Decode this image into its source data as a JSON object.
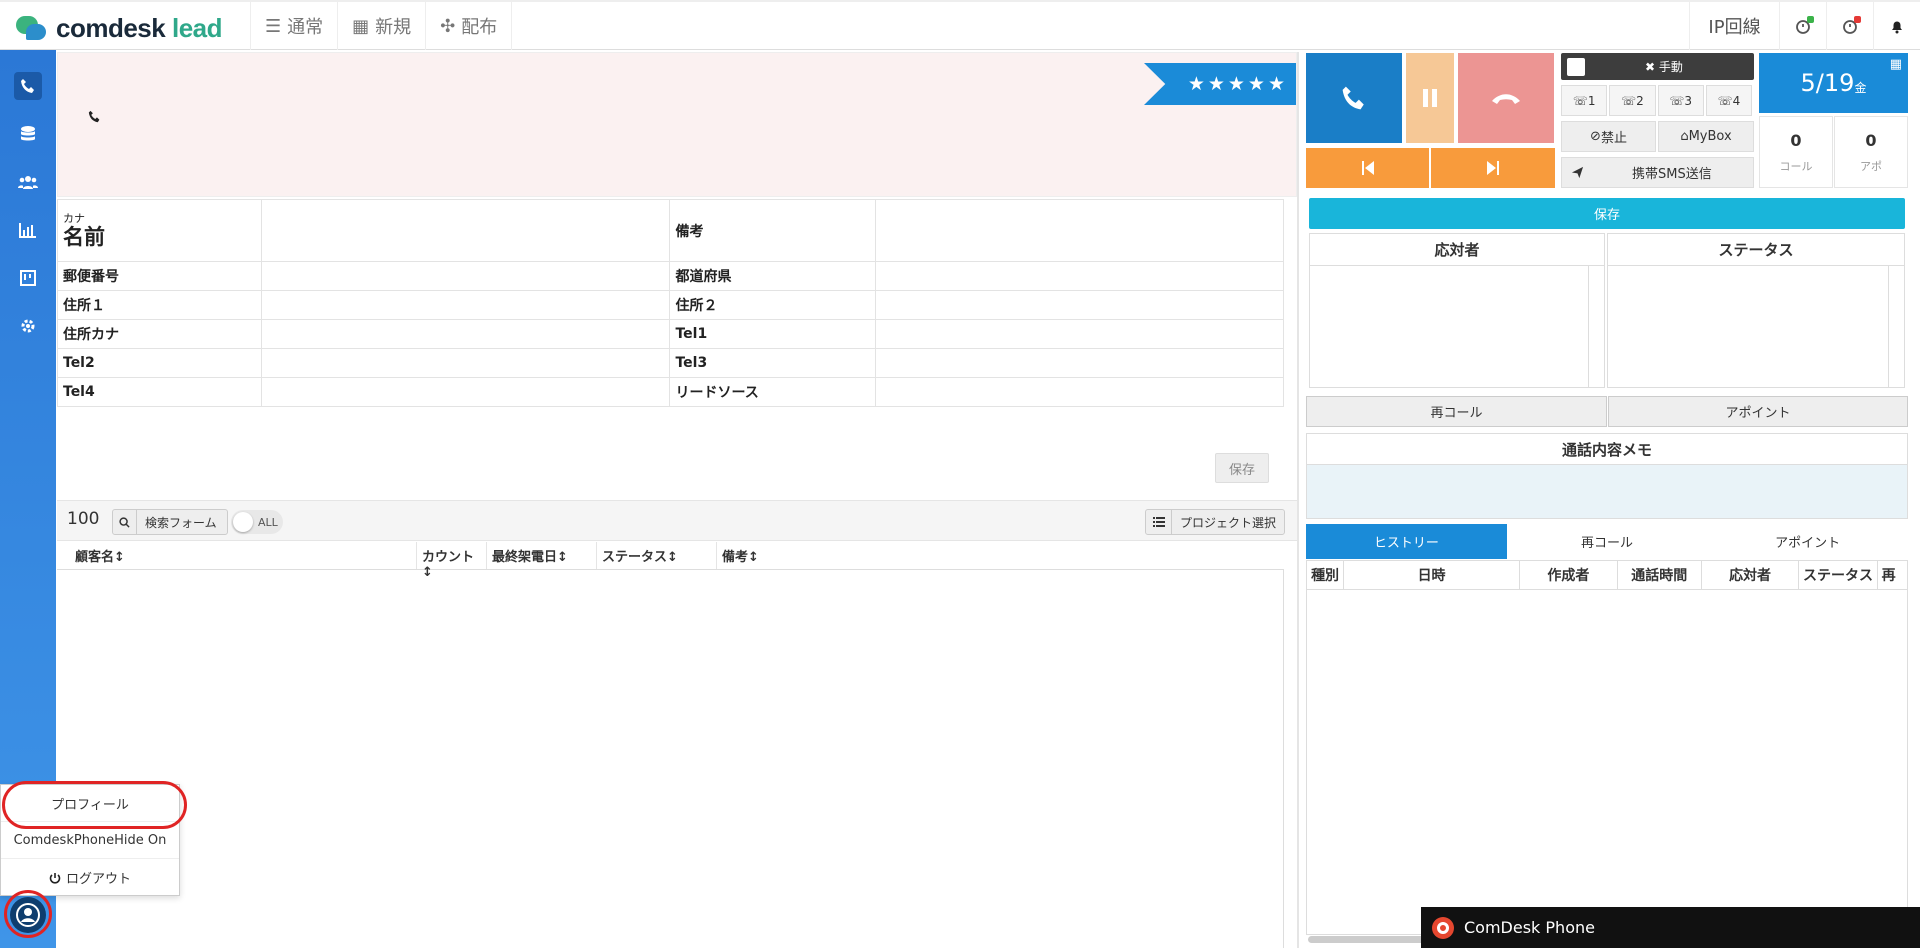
{
  "header": {
    "logo_part1": "comdesk",
    "logo_part2": "lead",
    "nav": [
      {
        "label": "通常",
        "icon": "list-icon"
      },
      {
        "label": "新規",
        "icon": "grid-icon"
      },
      {
        "label": "配布",
        "icon": "expand-icon"
      }
    ],
    "ip_label": "IP回線",
    "timer1_badge_color": "#3bb34a",
    "timer2_badge_color": "#e53935"
  },
  "sidebar": {
    "items": [
      "phone-icon",
      "database-icon",
      "users-icon",
      "chart-icon",
      "board-icon",
      "gear-icon"
    ]
  },
  "user_menu": {
    "profile": "プロフィール",
    "hide_phone": "ComdeskPhoneHide On",
    "logout": "ログアウト"
  },
  "banner": {
    "rating_stars": "★★★★★",
    "rating": 5
  },
  "customer": {
    "kana_label": "カナ",
    "name_label": "名前",
    "notes_label": "備考",
    "rows": [
      [
        "郵便番号",
        "都道府県"
      ],
      [
        "住所１",
        "住所２"
      ],
      [
        "住所カナ",
        "Tel1"
      ],
      [
        "Tel2",
        "Tel3"
      ],
      [
        "Tel4",
        "リードソース"
      ]
    ],
    "save_label": "保存"
  },
  "list_toolbar": {
    "count": "100",
    "search_label": "検索フォーム",
    "toggle_label": "ALL",
    "project_label": "プロジェクト選択"
  },
  "list_columns": [
    "顧客名",
    "カウント",
    "最終架電日",
    "ステータス",
    "備考"
  ],
  "call_panel": {
    "manual_label": "手動",
    "lines": [
      "1",
      "2",
      "3",
      "4"
    ],
    "block_label": "禁止",
    "mybox_label": "MyBox",
    "sms_label": "携帯SMS送信",
    "date": "5/19",
    "weekday": "金",
    "calls_count": "0",
    "calls_label": "コール",
    "appo_count": "0",
    "appo_label": "アポ"
  },
  "result_panel": {
    "save_label": "保存",
    "responder_label": "応対者",
    "status_label": "ステータス",
    "recall_label": "再コール",
    "appoint_label": "アポイント",
    "memo_label": "通話内容メモ"
  },
  "history": {
    "tabs": [
      "ヒストリー",
      "再コール",
      "アポイント"
    ],
    "active_tab": 0,
    "columns": [
      "種別",
      "日時",
      "作成者",
      "通話時間",
      "応対者",
      "ステータス",
      "再"
    ]
  },
  "phone_bar": {
    "title": "ComDesk Phone"
  }
}
